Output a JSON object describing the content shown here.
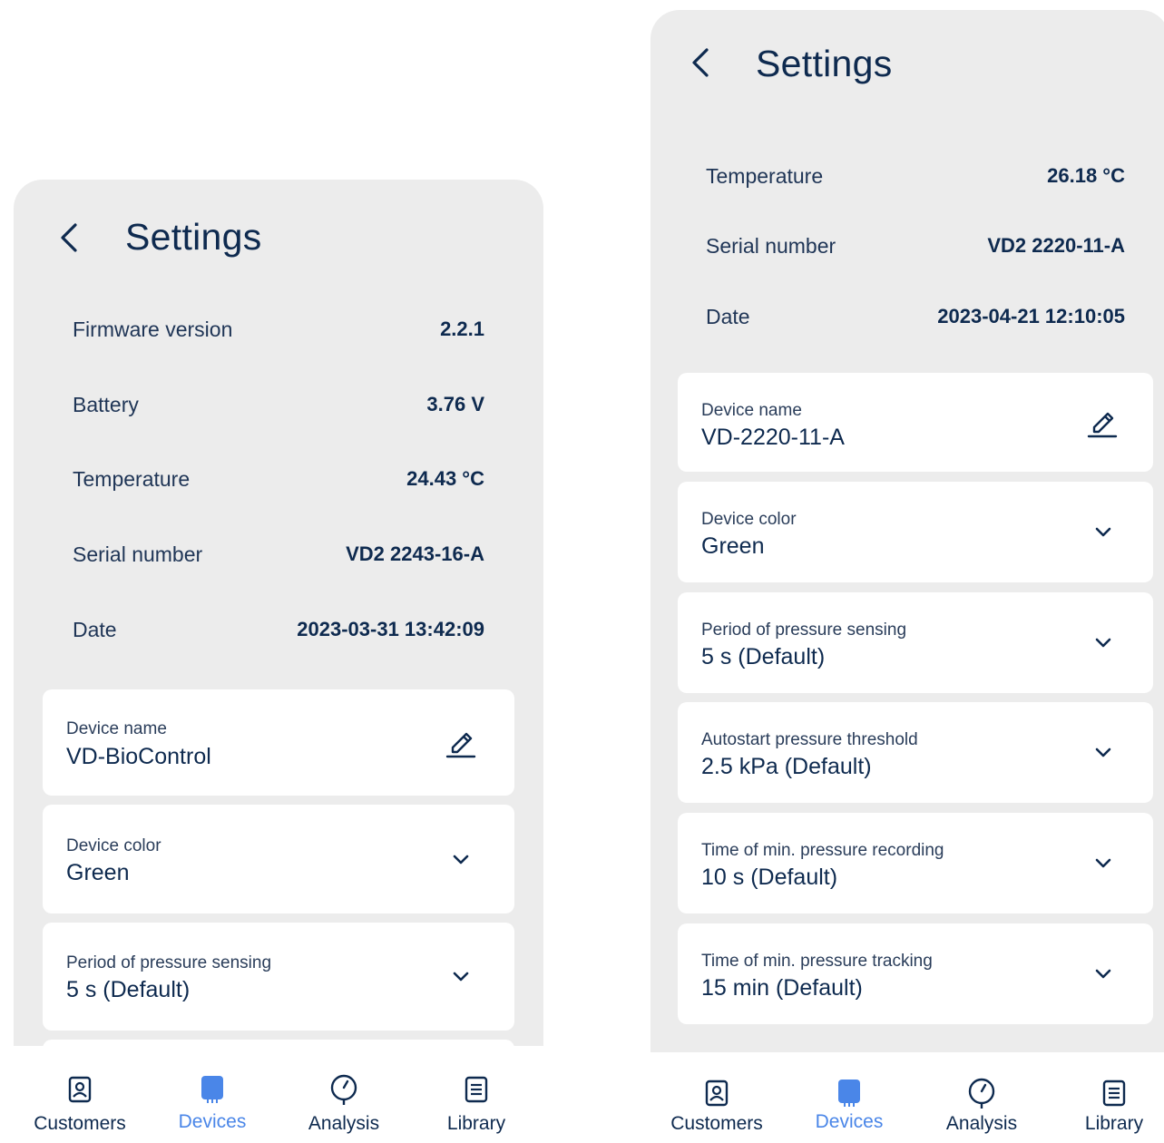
{
  "colors": {
    "accent": "#4a86e8",
    "text": "#0e2a4f",
    "panel": "#ececec"
  },
  "screens": [
    {
      "title": "Settings",
      "info": [
        {
          "label": "Firmware version",
          "value": "2.2.1"
        },
        {
          "label": "Battery",
          "value": "3.76 V"
        },
        {
          "label": "Temperature",
          "value": "24.43 °C"
        },
        {
          "label": "Serial number",
          "value": "VD2 2243-16-A"
        },
        {
          "label": "Date",
          "value": "2023-03-31 13:42:09"
        }
      ],
      "cards": [
        {
          "label": "Device name",
          "value": "VD-BioControl",
          "icon": "edit-icon"
        },
        {
          "label": "Device color",
          "value": "Green",
          "icon": "chevron-down-icon"
        },
        {
          "label": "Period of pressure sensing",
          "value": "5 s (Default)",
          "icon": "chevron-down-icon"
        }
      ],
      "nav": [
        {
          "label": "Customers",
          "icon": "contact-icon"
        },
        {
          "label": "Devices",
          "icon": "device-icon",
          "active": true
        },
        {
          "label": "Analysis",
          "icon": "gauge-icon"
        },
        {
          "label": "Library",
          "icon": "document-icon"
        }
      ]
    },
    {
      "title": "Settings",
      "info": [
        {
          "label": "Temperature",
          "value": "26.18 °C"
        },
        {
          "label": "Serial number",
          "value": "VD2 2220-11-A"
        },
        {
          "label": "Date",
          "value": "2023-04-21 12:10:05"
        }
      ],
      "cards": [
        {
          "label": "Device name",
          "value": "VD-2220-11-A",
          "icon": "edit-icon"
        },
        {
          "label": "Device color",
          "value": "Green",
          "icon": "chevron-down-icon"
        },
        {
          "label": "Period of pressure sensing",
          "value": "5 s (Default)",
          "icon": "chevron-down-icon"
        },
        {
          "label": "Autostart pressure threshold",
          "value": "2.5 kPa (Default)",
          "icon": "chevron-down-icon"
        },
        {
          "label": "Time of min. pressure recording",
          "value": "10 s (Default)",
          "icon": "chevron-down-icon"
        },
        {
          "label": "Time of min. pressure tracking",
          "value": "15 min (Default)",
          "icon": "chevron-down-icon"
        }
      ],
      "nav": [
        {
          "label": "Customers",
          "icon": "contact-icon"
        },
        {
          "label": "Devices",
          "icon": "device-icon",
          "active": true
        },
        {
          "label": "Analysis",
          "icon": "gauge-icon"
        },
        {
          "label": "Library",
          "icon": "document-icon"
        }
      ]
    }
  ]
}
